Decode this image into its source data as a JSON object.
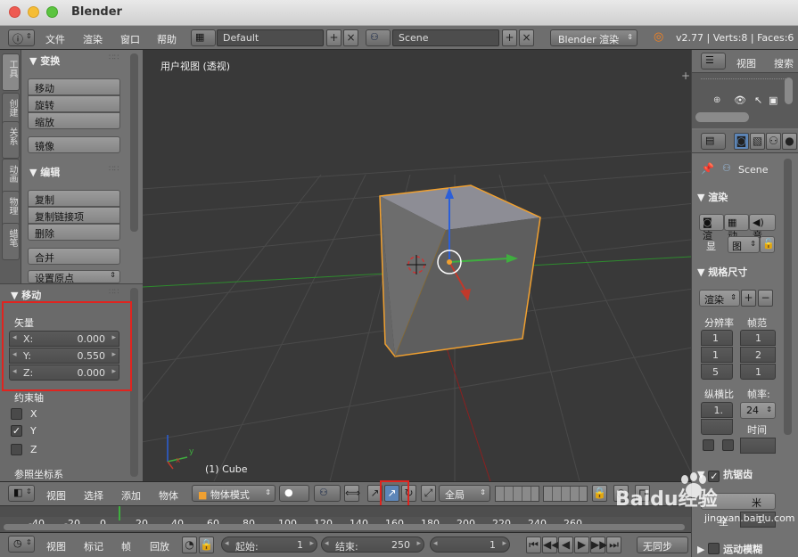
{
  "window": {
    "title": "Blender"
  },
  "info_bar": {
    "menus": [
      "文件",
      "渲染",
      "窗口",
      "帮助"
    ],
    "screen_layout": "Default",
    "scene": "Scene",
    "render_engine": "Blender 渲染",
    "stats": "v2.77 | Verts:8 | Faces:6 |"
  },
  "tool_tabs": [
    "工具",
    "创建",
    "关系",
    "动画",
    "物理",
    "蜡笔"
  ],
  "tools": {
    "transform_title": "变换",
    "transform_buttons": [
      "移动",
      "旋转",
      "缩放"
    ],
    "mirror": "镜像",
    "edit_title": "编辑",
    "edit_buttons": [
      "复制",
      "复制链接项",
      "删除"
    ],
    "join": "合并",
    "set_origin": "设置原点"
  },
  "operator": {
    "title": "移动",
    "vector_label": "矢量",
    "x_label": "X:",
    "x_value": "0.000",
    "y_label": "Y:",
    "y_value": "0.550",
    "z_label": "Z:",
    "z_value": "0.000",
    "constraint_label": "约束轴",
    "axis_x": "X",
    "axis_y": "Y",
    "axis_z": "Z",
    "axis_x_checked": false,
    "axis_y_checked": true,
    "axis_z_checked": false,
    "orientation_label": "参照坐标系"
  },
  "viewport": {
    "view_name": "用户视图 (透视)",
    "object_info": "(1) Cube",
    "axis_y": "y",
    "axis_x": "x"
  },
  "outliner": {
    "view_menu": "视图",
    "search_menu": "搜索"
  },
  "properties": {
    "scene_name": "Scene",
    "render_title": "渲染",
    "render_buttons": [
      "渲",
      "动",
      "音"
    ],
    "display_label": "显",
    "display_value": "图",
    "dimensions_title": "规格尺寸",
    "render_preset": "渲染",
    "resolution_label": "分辨率",
    "frame_range_label": "帧范",
    "res_values": [
      "1",
      "1",
      "5"
    ],
    "frame_values": [
      "1",
      "2",
      "1"
    ],
    "aspect_label": "纵横比",
    "frame_rate_label": "帧率:",
    "aspect_value": "1.",
    "frame_rate_value": "24",
    "time_label": "时间",
    "antialias_title": "抗锯齿",
    "motion_blur_title": "运动模糊",
    "aa_value": "米",
    "aa_full": "全",
    "aa_num": "1."
  },
  "view_header": {
    "menus": [
      "视图",
      "选择",
      "添加",
      "物体"
    ],
    "mode": "物体模式",
    "pivot": "全局"
  },
  "timeline": {
    "ticks": [
      "-40",
      "-20",
      "0",
      "20",
      "40",
      "60",
      "80",
      "100",
      "120",
      "140",
      "160",
      "180",
      "200",
      "220",
      "240",
      "260"
    ]
  },
  "time_header": {
    "menus": [
      "视图",
      "标记",
      "帧",
      "回放"
    ],
    "start_label": "起始:",
    "start_value": "1",
    "end_label": "结束:",
    "end_value": "250",
    "current_frame": "1",
    "sync": "无同步"
  },
  "watermark": {
    "text": "Baidu经验",
    "url": "jingyan.baidu.com"
  },
  "colors": {
    "selection_outline": "#f0a030",
    "x_axis": "#c0392b",
    "y_axis": "#3fae3f",
    "z_axis": "#2b5fd9",
    "highlight_box": "#e0241f"
  }
}
